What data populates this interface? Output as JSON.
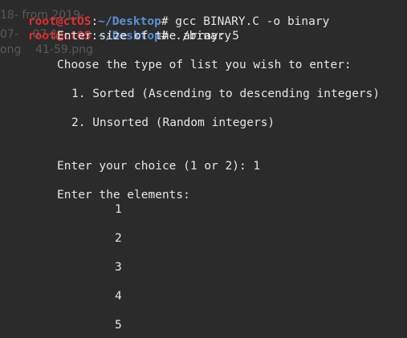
{
  "background_color": "#2b2b2b",
  "desktop_ghost_text": {
    "line1": "18- from 2019-",
    "line2": "07-    07-1",
    "line3": "ong    41-59.png"
  },
  "prompts": [
    {
      "user": "root@ctOS",
      "separator": ":",
      "path": "~/Desktop",
      "symbol": "#",
      "command": " gcc BINARY.C -o binary"
    },
    {
      "user": "root@ctOS",
      "separator": ":",
      "path": "~/Desktop",
      "symbol": "#",
      "command": " ./binary"
    }
  ],
  "output": {
    "size_prompt": "Enter size of the array: 5",
    "choose_type": "Choose the type of list you wish to enter:",
    "option1": "1. Sorted (Ascending to descending integers)",
    "option2": "2. Unsorted (Random integers)",
    "choice_prompt": "Enter your choice (1 or 2): 1",
    "elements_prompt": "Enter the elements:",
    "elements": [
      "1",
      "2",
      "3",
      "4",
      "5"
    ]
  },
  "colors": {
    "user": "#e03030",
    "path": "#5c8fd6",
    "text": "#e6e6e6"
  }
}
